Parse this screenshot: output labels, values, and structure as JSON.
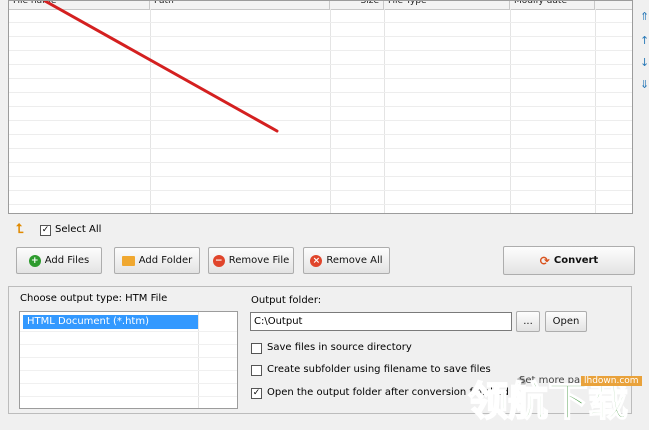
{
  "table": {
    "columns": [
      "File name",
      "Path",
      "Size",
      "File Type",
      "Modify date"
    ]
  },
  "toolbar": {
    "select_all_label": "Select All",
    "select_all_checked": true,
    "add_files": "Add Files",
    "add_folder": "Add Folder",
    "remove_file": "Remove File",
    "remove_all": "Remove All",
    "convert": "Convert"
  },
  "options": {
    "output_type_label": "Choose output type:  HTM File",
    "output_types": [
      "HTML Document (*.htm)"
    ],
    "output_folder_label": "Output folder:",
    "output_folder_value": "C:\\Output",
    "browse_label": "...",
    "open_label": "Open",
    "checkboxes": [
      {
        "label": "Save files in source directory",
        "checked": false
      },
      {
        "label": "Create subfolder using filename to save files",
        "checked": false
      },
      {
        "label": "Open the output folder after conversion finished",
        "checked": true
      }
    ],
    "more_params": "Set more parameters"
  },
  "watermark": {
    "site": "lhdown.com",
    "text": "领航下载"
  },
  "colors": {
    "selection": "#3399ff",
    "annotation_arrow": "#d42020",
    "add_icon": "#2e9b2e",
    "remove_icon": "#e0452b",
    "folder_icon": "#f0a830"
  }
}
